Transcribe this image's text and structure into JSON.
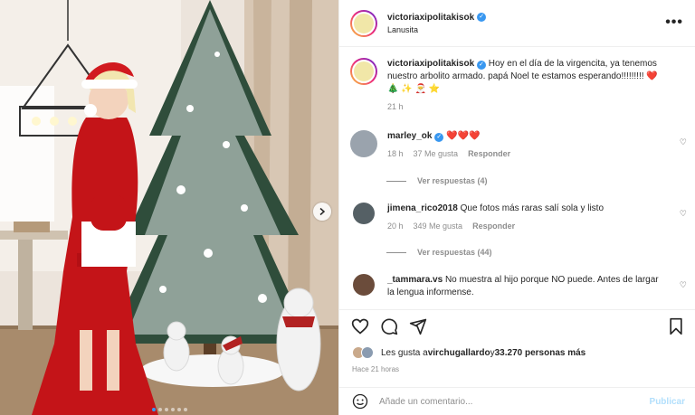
{
  "post": {
    "author": "victoriaxipolitakisok",
    "location": "Lanusita",
    "caption_user": "victoriaxipolitakisok",
    "caption_text": "Hoy en el día de la virgencita, ya tenemos nuestro arbolito armado. papá Noel te estamos esperando!!!!!!!!! ❤️ 🎄 ✨ 🎅 ⭐",
    "caption_time": "21 h"
  },
  "comments": [
    {
      "user": "marley_ok",
      "verified": true,
      "text": "❤️❤️❤️",
      "time": "18 h",
      "likes": "37 Me gusta",
      "reply": "Responder",
      "view_replies": "Ver respuestas (4)"
    },
    {
      "user": "jimena_rico2018",
      "verified": false,
      "text": "Que fotos más raras salí sola y listo",
      "time": "20 h",
      "likes": "349 Me gusta",
      "reply": "Responder",
      "view_replies": "Ver respuestas (44)"
    },
    {
      "user": "_tammara.vs",
      "verified": false,
      "text": "No muestra al hijo porque NO puede. Antes de largar la lengua informense.",
      "time": "",
      "likes": "",
      "reply": ""
    }
  ],
  "likes_summary": {
    "prefix": "Les gusta a ",
    "user": "virchugallardo",
    "middle": " y ",
    "count": "33.270 personas más"
  },
  "timestamp": "Hace 21 horas",
  "add_comment": {
    "placeholder": "Añade un comentario...",
    "publish_label": "Publicar"
  },
  "carousel": {
    "total_slides": 6,
    "active_index": 0
  },
  "icons": {
    "header_more": "more-horizontal-icon",
    "like": "heart-outline-icon",
    "comment": "comment-bubble-icon",
    "share": "paper-plane-icon",
    "save": "bookmark-icon",
    "emoji": "smiley-icon",
    "next": "chevron-right-icon"
  },
  "colors": {
    "verified": "#3897f0",
    "muted": "#8e8e8e",
    "publish_disabled": "#b2dffc"
  }
}
